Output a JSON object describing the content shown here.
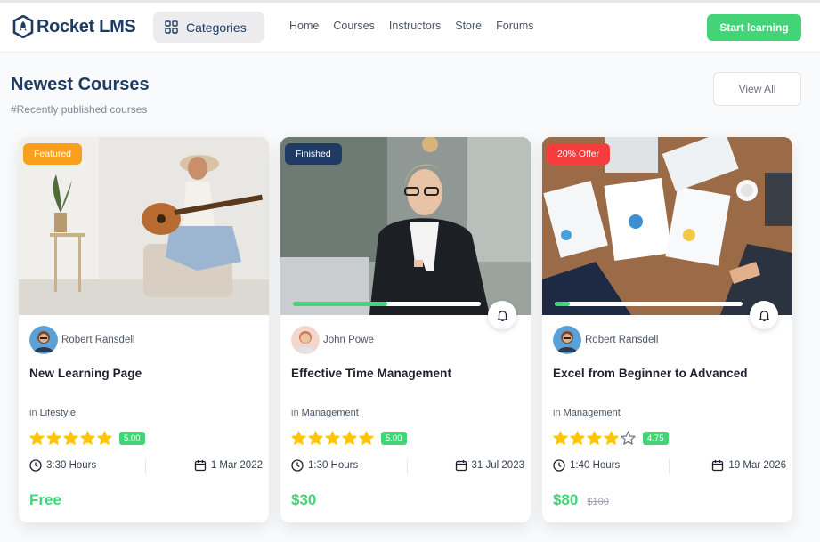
{
  "header": {
    "logo_text": "Rocket LMS",
    "categories_label": "Categories",
    "nav": [
      "Home",
      "Courses",
      "Instructors",
      "Store",
      "Forums"
    ],
    "cta_label": "Start learning",
    "accent": "#43d477",
    "brand": "#1f3b64"
  },
  "section": {
    "title": "Newest Courses",
    "subtitle": "#Recently published courses",
    "view_all": "View All"
  },
  "courses": [
    {
      "badge": "Featured",
      "badge_color": "#f8a01b",
      "author": "Robert Ransdell",
      "title": "New Learning Page",
      "category_prefix": "in",
      "category": "Lifestyle",
      "rating": 5,
      "rating_label": "5.00",
      "duration": "3:30 Hours",
      "date": "1 Mar 2022",
      "price": "Free",
      "old_price": "",
      "progress": null,
      "has_bell": false
    },
    {
      "badge": "Finished",
      "badge_color": "#1f3b64",
      "author": "John Powe",
      "title": "Effective Time Management",
      "category_prefix": "in",
      "category": "Management",
      "rating": 5,
      "rating_label": "5.00",
      "duration": "1:30 Hours",
      "date": "31 Jul 2023",
      "price": "$30",
      "old_price": "",
      "progress": 0.5,
      "has_bell": true
    },
    {
      "badge": "20% Offer",
      "badge_color": "#f63c3c",
      "author": "Robert Ransdell",
      "title": "Excel from Beginner to Advanced",
      "category_prefix": "in",
      "category": "Management",
      "rating": 4,
      "rating_label": "4.75",
      "duration": "1:40 Hours",
      "date": "19 Mar 2026",
      "price": "$80",
      "old_price": "$100",
      "progress": 0.08,
      "has_bell": true
    }
  ]
}
